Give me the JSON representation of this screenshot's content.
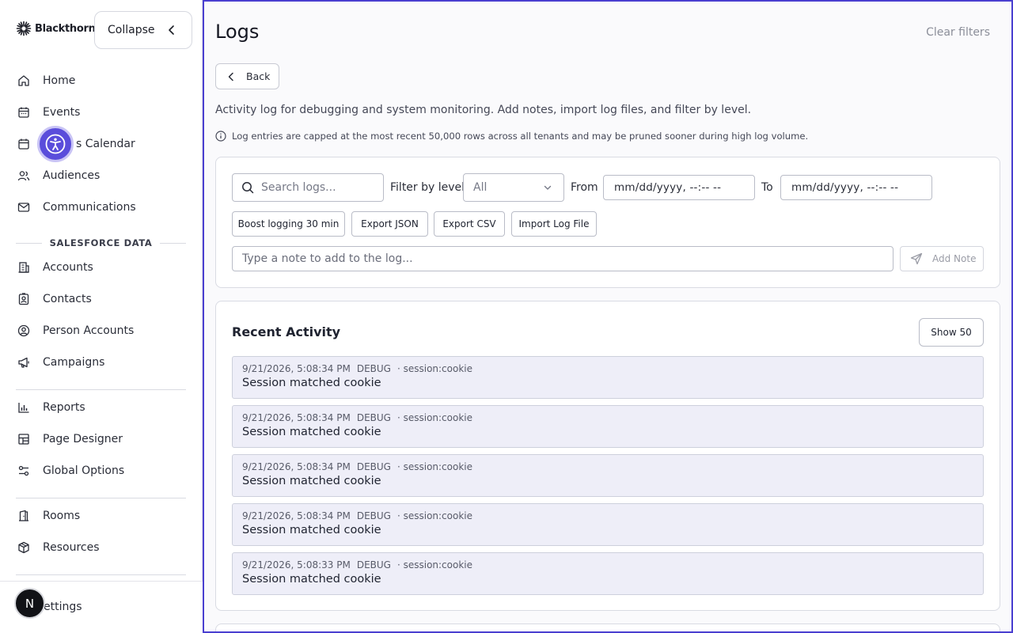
{
  "sidebar": {
    "brand": "Blackthorn",
    "collapse_label": "Collapse",
    "nav_main": [
      {
        "label": "Home",
        "icon": "home-icon"
      },
      {
        "label": "Events",
        "icon": "calendar-icon"
      },
      {
        "label": "s Calendar",
        "icon": "calendar-icon"
      },
      {
        "label": "Audiences",
        "icon": "users-icon"
      },
      {
        "label": "Communications",
        "icon": "mail-icon"
      }
    ],
    "section_salesforce": "SALESFORCE DATA",
    "nav_salesforce": [
      {
        "label": "Accounts",
        "icon": "building-icon"
      },
      {
        "label": "Contacts",
        "icon": "contact-card-icon"
      },
      {
        "label": "Person Accounts",
        "icon": "user-circle-icon"
      },
      {
        "label": "Campaigns",
        "icon": "megaphone-icon"
      }
    ],
    "nav_tools": [
      {
        "label": "Reports",
        "icon": "bar-chart-icon"
      },
      {
        "label": "Page Designer",
        "icon": "layout-icon"
      },
      {
        "label": "Global Options",
        "icon": "sliders-icon"
      }
    ],
    "nav_venue": [
      {
        "label": "Rooms",
        "icon": "door-icon"
      },
      {
        "label": "Resources",
        "icon": "box-icon"
      }
    ],
    "settings_label": "ettings",
    "avatar_initial": "N"
  },
  "header": {
    "title": "Logs",
    "clear_filters": "Clear filters",
    "back_label": "Back",
    "description": "Activity log for debugging and system monitoring. Add notes, import log files, and filter by level.",
    "notice": "Log entries are capped at the most recent 50,000 rows across all tenants and may be pruned sooner during high log volume."
  },
  "filters": {
    "search_placeholder": "Search logs...",
    "level_label": "Filter by level",
    "level_value": "All",
    "from_label": "From",
    "from_value": "mm/dd/yyyy, --:-- --",
    "to_label": "To",
    "to_value": "mm/dd/yyyy, --:-- --",
    "buttons": [
      "Boost logging 30 min",
      "Export JSON",
      "Export CSV",
      "Import Log File"
    ],
    "note_placeholder": "Type a note to add to the log...",
    "add_note_label": "Add Note"
  },
  "activity": {
    "title": "Recent Activity",
    "show_label": "Show 50",
    "entries": [
      {
        "timestamp": "9/21/2026, 5:08:34 PM",
        "level": "DEBUG",
        "source": "· session:cookie",
        "message": "Session matched cookie"
      },
      {
        "timestamp": "9/21/2026, 5:08:34 PM",
        "level": "DEBUG",
        "source": "· session:cookie",
        "message": "Session matched cookie"
      },
      {
        "timestamp": "9/21/2026, 5:08:34 PM",
        "level": "DEBUG",
        "source": "· session:cookie",
        "message": "Session matched cookie"
      },
      {
        "timestamp": "9/21/2026, 5:08:34 PM",
        "level": "DEBUG",
        "source": "· session:cookie",
        "message": "Session matched cookie"
      },
      {
        "timestamp": "9/21/2026, 5:08:33 PM",
        "level": "DEBUG",
        "source": "· session:cookie",
        "message": "Session matched cookie"
      }
    ]
  },
  "colors": {
    "accent": "#4a3fd0",
    "accessibility_button": "#5a4ddb",
    "log_row_bg": "#eeeef8"
  }
}
